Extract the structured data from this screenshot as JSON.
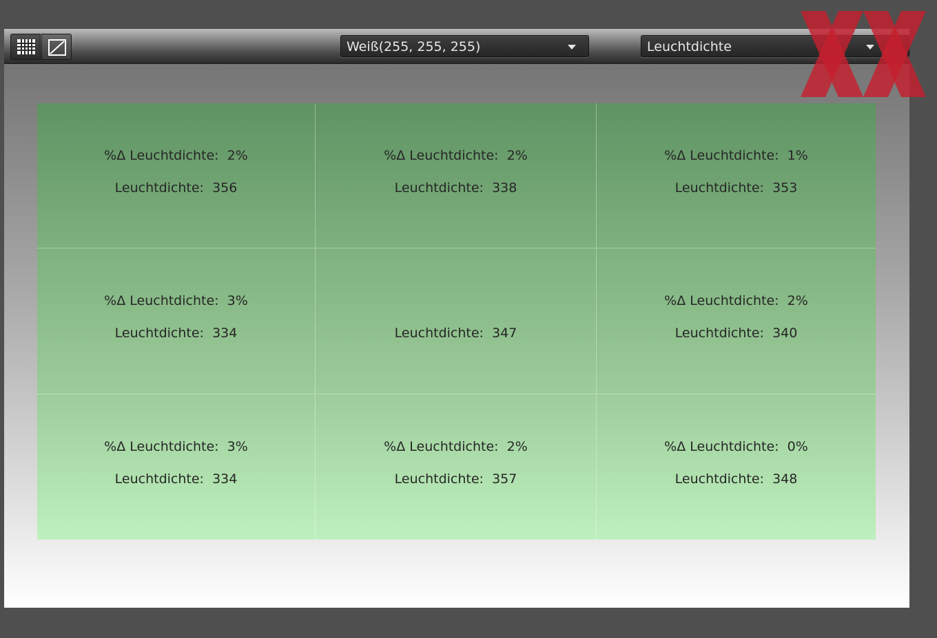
{
  "toolbar": {
    "view_buttons": [
      {
        "icon": "grid-icon",
        "active": true
      },
      {
        "icon": "graph-icon",
        "active": false
      }
    ],
    "color_dropdown": {
      "value": "Weiß(255, 255, 255)"
    },
    "metric_dropdown": {
      "value": "Leuchtdichte"
    }
  },
  "grid": {
    "delta_label": "%Δ Leuchtdichte:",
    "luminance_label": "Leuchtdichte:",
    "cells": [
      {
        "delta": "2%",
        "luminance": "356"
      },
      {
        "delta": "2%",
        "luminance": "338"
      },
      {
        "delta": "1%",
        "luminance": "353"
      },
      {
        "delta": "3%",
        "luminance": "334"
      },
      {
        "delta": null,
        "luminance": "347"
      },
      {
        "delta": "2%",
        "luminance": "340"
      },
      {
        "delta": "3%",
        "luminance": "334"
      },
      {
        "delta": "2%",
        "luminance": "357"
      },
      {
        "delta": "0%",
        "luminance": "348"
      }
    ]
  },
  "colors": {
    "cell_top": "#5f9363",
    "cell_bottom": "#bef0bf",
    "watermark": "#c4202d"
  }
}
